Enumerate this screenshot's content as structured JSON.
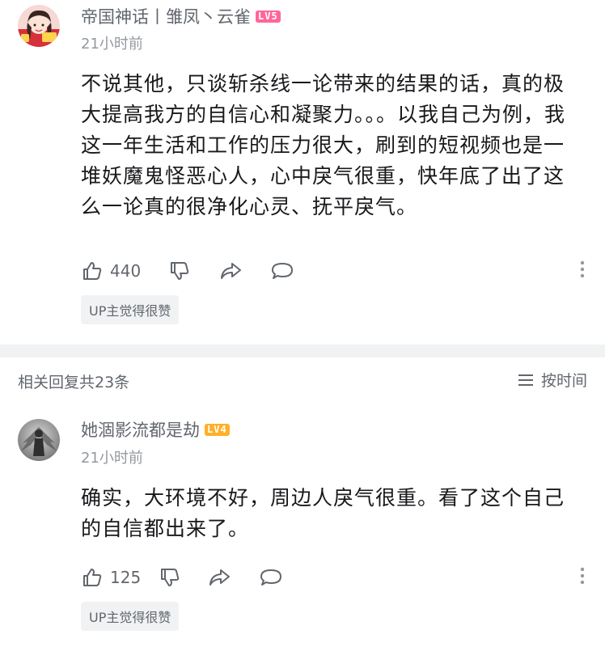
{
  "comments": [
    {
      "username": "帝国神话丨雏凤丶云雀",
      "level": "LV5",
      "level_color": "#ff6699",
      "time": "21小时前",
      "text": "不说其他，只谈斩杀线一论带来的结果的话，真的极大提高我方的自信心和凝聚力。。。以我自己为例，我这一年生活和工作的压力很大，刷到的短视频也是一堆妖魔鬼怪恶心人，心中戾气很重，快年底了出了这么一论真的很净化心灵、抚平戾气。",
      "likes": "440",
      "up_badge": "UP主觉得很赞",
      "icons": [
        "thumbs-up-icon",
        "thumbs-down-icon",
        "share-icon",
        "comment-bubble-icon",
        "more-vertical-icon"
      ]
    },
    {
      "username": "她涸影流都是劫",
      "level": "LV4",
      "level_color": "#ffb027",
      "time": "21小时前",
      "text": "确实，大环境不好，周边人戾气很重。看了这个自己的自信都出来了。",
      "likes": "125",
      "up_badge": "UP主觉得很赞",
      "icons": [
        "thumbs-up-icon",
        "thumbs-down-icon",
        "share-icon",
        "comment-bubble-icon",
        "more-vertical-icon"
      ]
    }
  ],
  "reply_section": {
    "count_label": "相关回复共23条",
    "sort_label": "按时间",
    "sort_icon": "list-icon"
  },
  "colors": {
    "text_primary": "#18191c",
    "text_secondary": "#61666d",
    "text_muted": "#9499a0",
    "separator": "#f1f2f3"
  }
}
